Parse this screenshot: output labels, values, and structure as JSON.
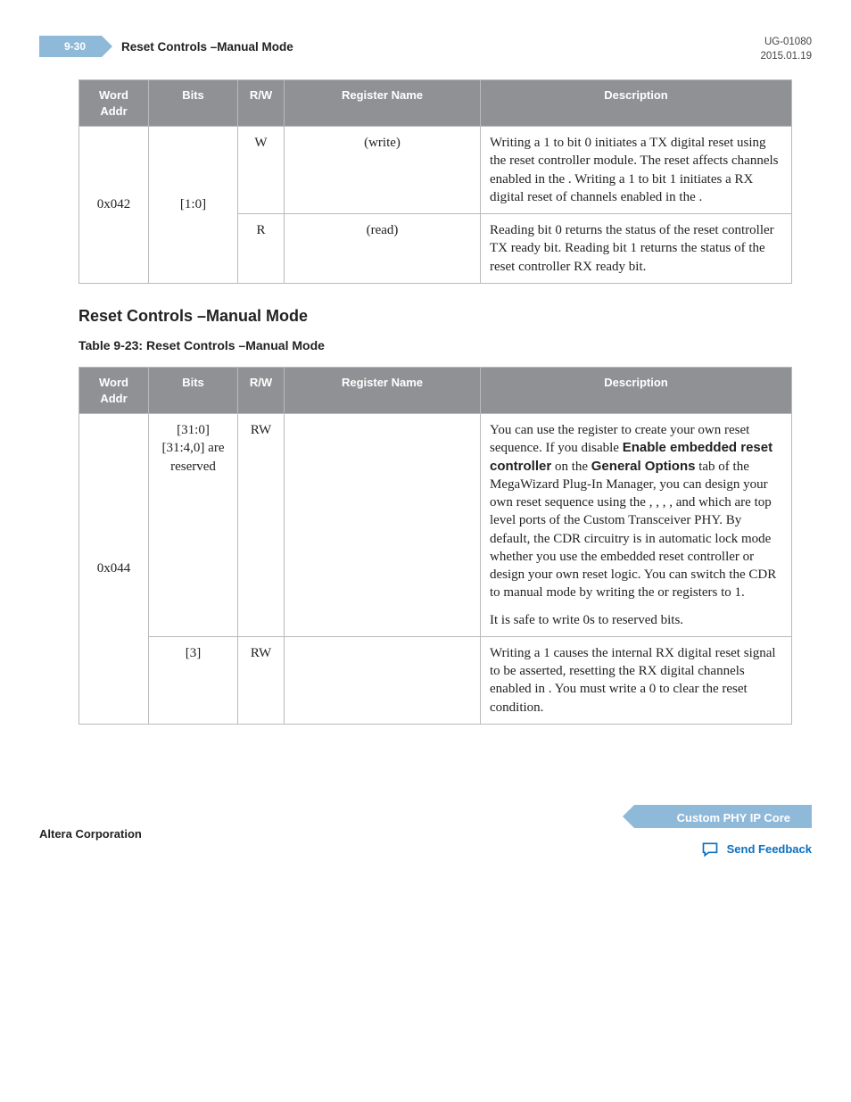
{
  "header": {
    "page_tag": "9-30",
    "section": "Reset Controls –Manual Mode",
    "doc_id": "UG-01080",
    "date": "2015.01.19"
  },
  "table_headers": {
    "word_addr": "Word Addr",
    "bits": "Bits",
    "rw": "R/W",
    "reg_name": "Register Name",
    "desc": "Description"
  },
  "table1": {
    "r0": {
      "word_addr": "0x042",
      "bits": "[1:0]",
      "rw": "W",
      "reg_name": "(write)",
      "desc": "Writing a 1 to bit 0 initiates a TX digital reset using the reset controller module. The reset affects channels enabled in the . Writing a 1 to bit 1 initiates a RX digital reset of channels enabled in the ."
    },
    "r1": {
      "rw": "R",
      "reg_name": "(read)",
      "desc": "Reading bit 0 returns the status of the reset controller TX ready bit. Reading bit 1 returns the status of the reset controller RX ready bit."
    }
  },
  "section2": {
    "heading": "Reset Controls –Manual Mode",
    "table_caption": "Table 9-23: Reset Controls –Manual Mode"
  },
  "table2": {
    "r0": {
      "word_addr": "0x044",
      "bits": "[31:0]\n[31:4,0] are reserved",
      "rw": "RW",
      "reg_name": "",
      "desc_parts": {
        "p1": "You can use the",
        "p2": "register to create your own reset sequence. If you disable ",
        "b1": "Enable embedded reset controller",
        "p3": " on the ",
        "b2": "General Options",
        "p4": " tab of the MegaWizard Plug-In Manager, you can design your own reset sequence using the , , , , and which are top level ports of the Custom Transceiver PHY. By default, the CDR circuitry is in automatic lock mode whether you use the embedded reset controller or design your own reset logic. You can switch the CDR to manual mode by writing the or registers to 1.",
        "safe": "It is safe to write 0s to reserved bits."
      }
    },
    "r1": {
      "bits": "[3]",
      "rw": "RW",
      "reg_name": "",
      "desc": "Writing a 1 causes the internal RX digital reset signal to be asserted, resetting the RX digital channels enabled in . You must write a 0 to clear the reset condition."
    }
  },
  "footer": {
    "corp": "Altera Corporation",
    "core": "Custom PHY IP Core",
    "feedback": "Send Feedback"
  }
}
